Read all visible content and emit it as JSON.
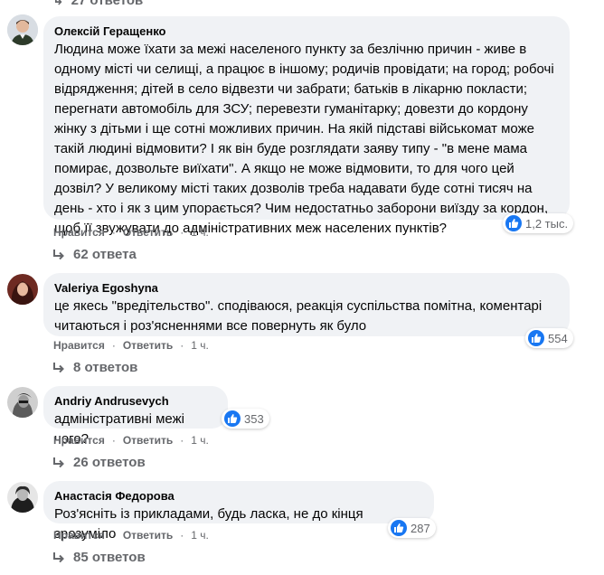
{
  "top_partial_label": "27 ответов",
  "actions_labels": {
    "like": "Нравится",
    "reply": "Ответить"
  },
  "colors": {
    "like_blue": "#1877f2",
    "bubble_bg": "#f0f2f5",
    "muted": "#65676b"
  },
  "comments": [
    {
      "author": "Олексій Геращенко",
      "text": "Людина може їхати за межі населеного пункту за безлічню причин - живе в одному місті чи селищі, а працює в іншому; родичів провідати; на город; робочі відрядження; дітей в село відвезти чи забрати; батьків в лікарню покласти; перегнати автомобіль для ЗСУ; перевезти гуманітарку; довезти до кордону жінку з дітьми і ще сотні можливих причин. На якій підставі військомат може такій людині відмовити? І як він буде розглядати заяву типу - \"в мене мама помирає, дозвольте виїхати\". А якщо не може відмовити, то для чого цей дозвіл? У великому місті таких дозволів треба надавати буде сотні тисяч на день - хто і як з цим упорається? Чим недостатньо заборони виїзду за кордон, щоб її звужувати до адміністративних меж населених пунктів?",
      "reactions": "1,2 тыс.",
      "time": "1 ч.",
      "replies": "62 ответа",
      "avatar_icon": "user-photo-icon"
    },
    {
      "author": "Valeriya Egoshyna",
      "text": "це якесь \"вредітельство\". сподіваюся, реакція суспільства помітна, коментарі читаються і роз'ясненнями все повернуть як було",
      "reactions": "554",
      "time": "1 ч.",
      "replies": "8 ответов",
      "avatar_icon": "user-photo-icon"
    },
    {
      "author": "Andriy Andrusevych",
      "text": "адміністративні межі чого?",
      "reactions": "353",
      "time": "1 ч.",
      "replies": "26 ответов",
      "avatar_icon": "user-photo-icon"
    },
    {
      "author": "Анастасія Федорова",
      "text": "Роз'ясніть із прикладами, будь ласка, не до кінця зрозуміло",
      "reactions": "287",
      "time": "1 ч.",
      "replies": "85 ответов",
      "avatar_icon": "user-photo-icon"
    }
  ]
}
